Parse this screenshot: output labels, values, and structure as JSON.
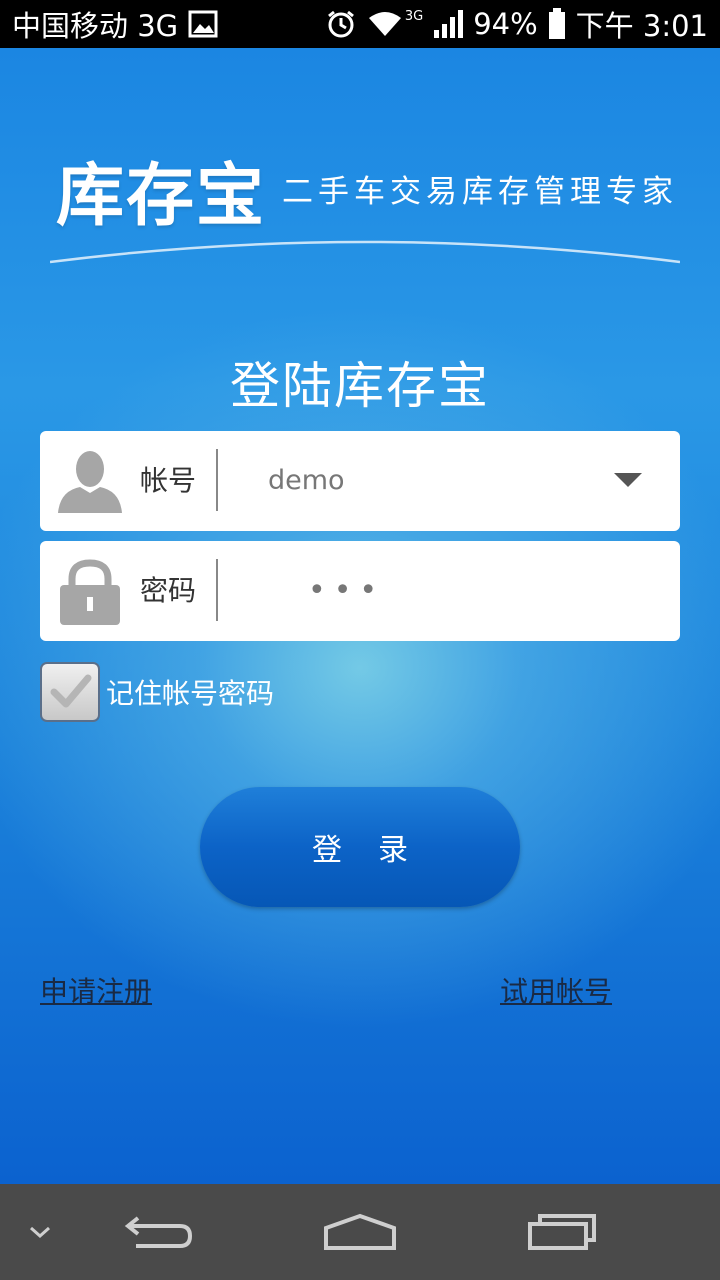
{
  "status_bar": {
    "carrier": "中国移动 3G",
    "network_badge": "3G",
    "battery": "94%",
    "time": "下午 3:01",
    "icons": [
      "image-icon",
      "alarm-icon",
      "wifi-icon",
      "signal-icon",
      "battery-icon"
    ]
  },
  "brand": {
    "name": "库存宝",
    "tagline": "二手车交易库存管理专家"
  },
  "login": {
    "title": "登陆库存宝",
    "account_label": "帐号",
    "account_value": "demo",
    "password_label": "密码",
    "password_mask": "•••",
    "remember_label": "记住帐号密码",
    "remember_checked": true,
    "submit_label": "登录"
  },
  "links": {
    "register": "申请注册",
    "trial": "试用帐号"
  },
  "nav_bar": {
    "icons": [
      "chevron-down-icon",
      "back-icon",
      "home-icon",
      "recent-apps-icon"
    ]
  },
  "colors": {
    "background": "#1b86e2",
    "button": "#0c63c7",
    "nav_bar": "#4a4a4a"
  }
}
